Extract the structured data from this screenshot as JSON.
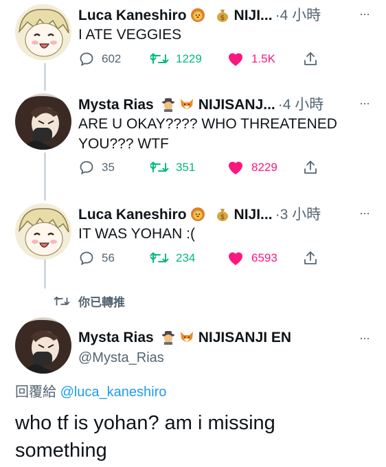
{
  "tweets": [
    {
      "name": "Luca Kaneshiro",
      "org": "NIJI...",
      "separator": "·",
      "time": "4 小時",
      "text": "I ATE VEGGIES",
      "replies": "602",
      "retweets": "1229",
      "likes": "1.5K",
      "liked": true
    },
    {
      "name": "Mysta Rias",
      "org": "NIJISANJ...",
      "separator": "·",
      "time": "4 小時",
      "text": "ARE U OKAY???? WHO THREATENED YOU??? WTF",
      "replies": "35",
      "retweets": "351",
      "likes": "8229",
      "liked": true
    },
    {
      "name": "Luca Kaneshiro",
      "org": "NIJI...",
      "separator": "·",
      "time": "3 小時",
      "text": "IT WAS YOHAN :(",
      "replies": "56",
      "retweets": "234",
      "likes": "6593",
      "liked": true
    }
  ],
  "retweeted_label": "你已轉推",
  "main_tweet": {
    "name": "Mysta Rias",
    "org": "NIJISANJI EN",
    "handle": "@Mysta_Rias",
    "reply_prefix": "回覆給",
    "reply_mention": "@luca_kaneshiro",
    "text": "who tf is yohan? am i missing something"
  },
  "more_symbol": "···",
  "icons": {
    "reply": "reply-icon",
    "retweet": "retweet-icon",
    "like": "heart-icon",
    "share": "share-icon",
    "lion": "lion-emoji-icon",
    "moneybag": "money-bag-emoji-icon",
    "detective": "detective-emoji-icon",
    "fox": "fox-emoji-icon"
  },
  "colors": {
    "retweet": "#00ba7c",
    "like": "#f91880",
    "link": "#1d9bf0",
    "secondary": "#536471",
    "thread_line": "#cfd9de"
  }
}
